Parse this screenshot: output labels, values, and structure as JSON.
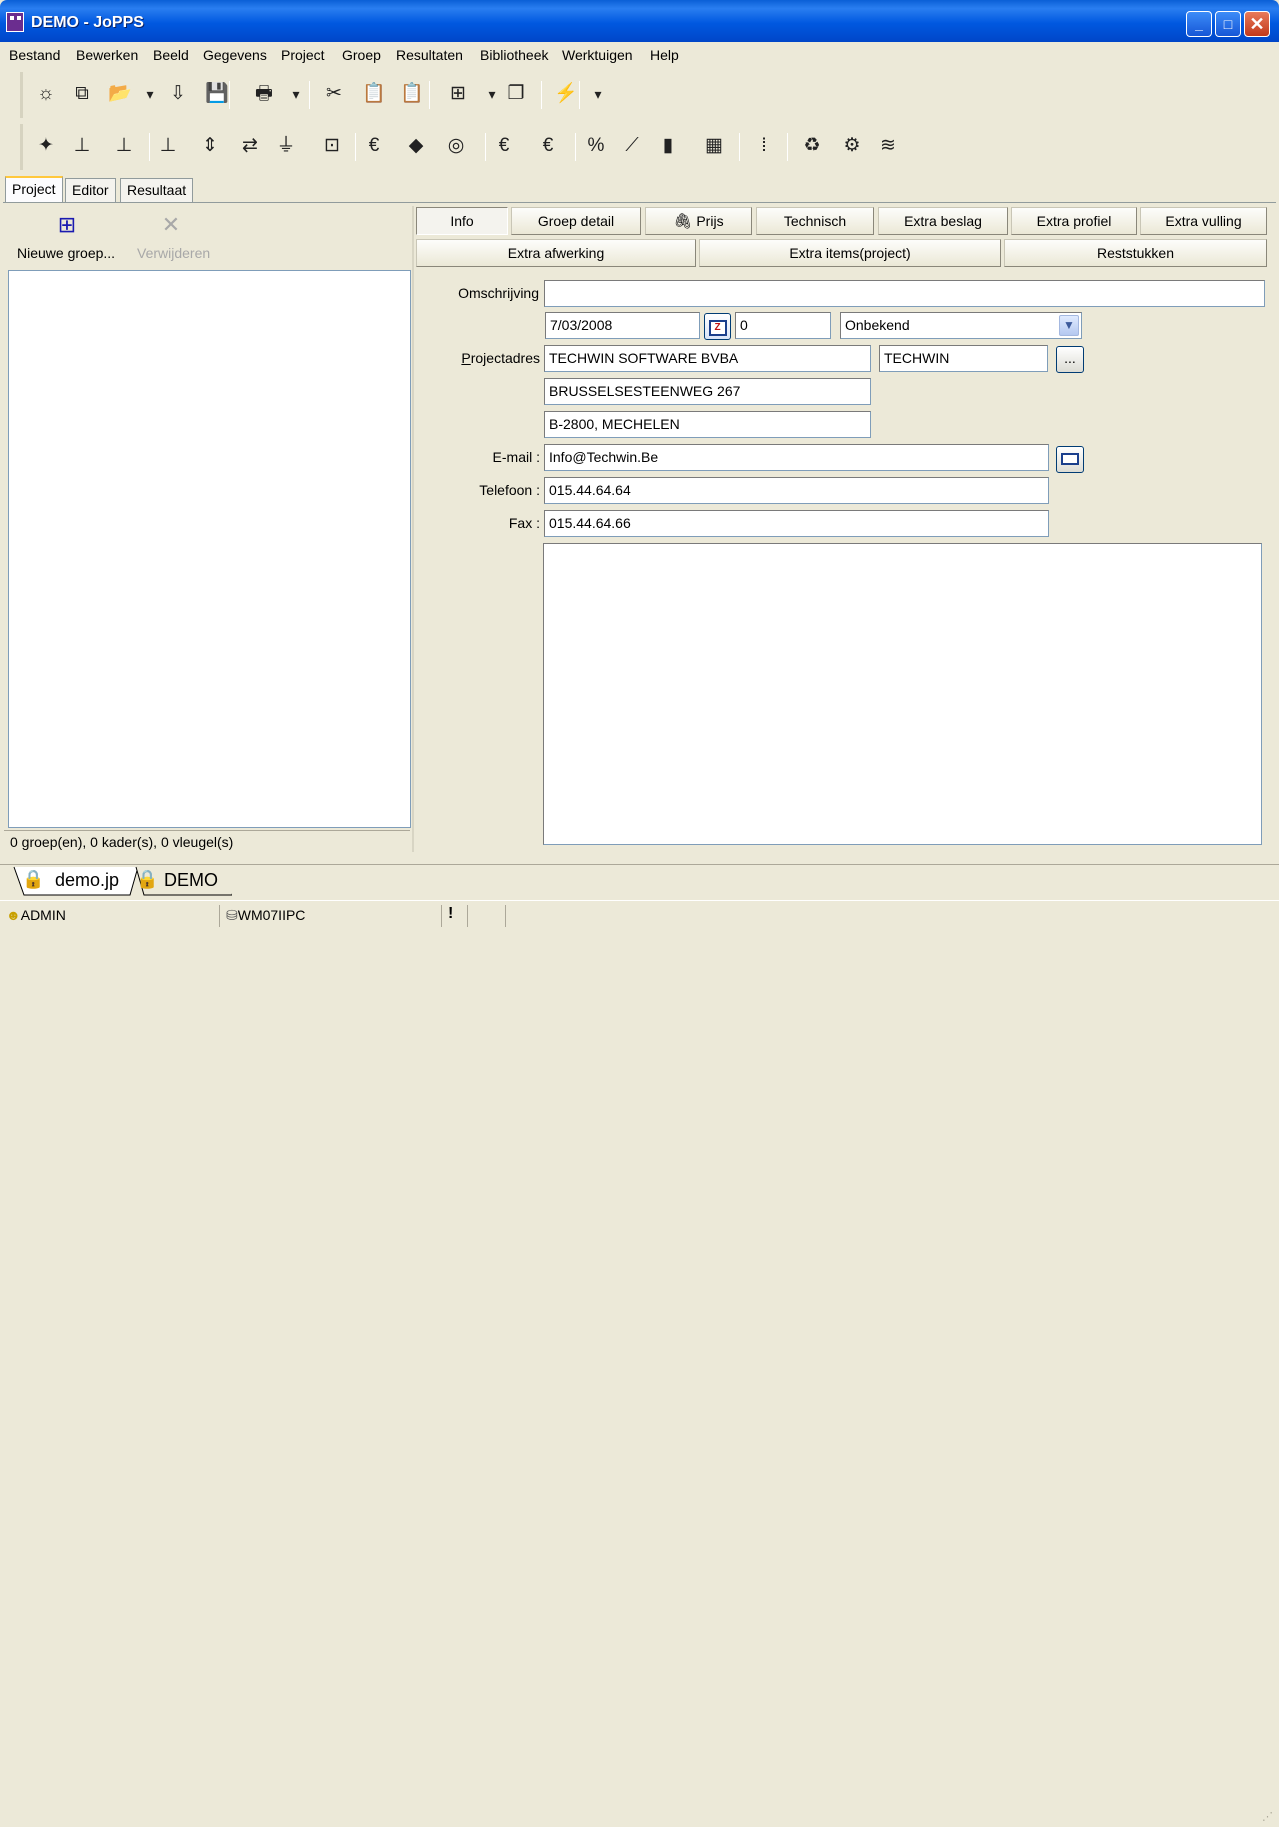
{
  "window": {
    "title": "DEMO - JoPPS",
    "minimize_glyph": "_",
    "maximize_glyph": "□",
    "close_glyph": "✕"
  },
  "menu": [
    "Bestand",
    "Bewerken",
    "Beeld",
    "Gegevens",
    "Project",
    "Groep",
    "Resultaten",
    "Bibliotheek",
    "Werktuigen",
    "Help"
  ],
  "toolbar1_icons": [
    {
      "name": "new-icon",
      "glyph": "☼"
    },
    {
      "name": "copy-icon",
      "glyph": "⧉"
    },
    {
      "name": "open-folder-icon",
      "glyph": "📂"
    },
    {
      "name": "dropdown-arrow-icon",
      "glyph": "▾"
    },
    {
      "name": "import-icon",
      "glyph": "⇩"
    },
    {
      "name": "save-icon",
      "glyph": "💾"
    },
    {
      "name": "print-icon",
      "glyph": "🖶"
    },
    {
      "name": "dropdown-arrow-icon",
      "glyph": "▾"
    },
    {
      "name": "cut-icon",
      "glyph": "✂"
    },
    {
      "name": "paste-icon",
      "glyph": "📋"
    },
    {
      "name": "paste-special-icon",
      "glyph": "📋"
    },
    {
      "name": "group-icon",
      "glyph": "⊞"
    },
    {
      "name": "dropdown-arrow-icon",
      "glyph": "▾"
    },
    {
      "name": "windows-icon",
      "glyph": "❐"
    },
    {
      "name": "lightning-icon",
      "glyph": "⚡"
    },
    {
      "name": "dropdown-arrow-icon",
      "glyph": "▾"
    }
  ],
  "toolbar2_icons": [
    {
      "name": "profile-wizard-icon",
      "glyph": "✦"
    },
    {
      "name": "profile-stack-icon",
      "glyph": "⊥"
    },
    {
      "name": "profile-icon",
      "glyph": "⊥"
    },
    {
      "name": "profile-price-icon",
      "glyph": "⊥"
    },
    {
      "name": "profile-dimension-icon",
      "glyph": "⇕"
    },
    {
      "name": "profile-connect-icon",
      "glyph": "⇄"
    },
    {
      "name": "weld-icon",
      "glyph": "⏚"
    },
    {
      "name": "frame-icon",
      "glyph": "⊡"
    },
    {
      "name": "glass-price-icon",
      "glyph": "€"
    },
    {
      "name": "cube-icon",
      "glyph": "◆"
    },
    {
      "name": "hardware-icon",
      "glyph": "◎"
    },
    {
      "name": "panel-price-icon",
      "glyph": "€"
    },
    {
      "name": "accessory-price-icon",
      "glyph": "€"
    },
    {
      "name": "discount-icon",
      "glyph": "%"
    },
    {
      "name": "price-graph-icon",
      "glyph": "⟋"
    },
    {
      "name": "price-chart-icon",
      "glyph": "▮"
    },
    {
      "name": "price-table-icon",
      "glyph": "▦"
    },
    {
      "name": "traffic-light-icon",
      "glyph": "⦙"
    },
    {
      "name": "recycle-icon",
      "glyph": "♻"
    },
    {
      "name": "gear-icon",
      "glyph": "⚙"
    },
    {
      "name": "coins-icon",
      "glyph": "≋"
    }
  ],
  "tabs": {
    "project": "Project",
    "editor": "Editor",
    "resultaat": "Resultaat"
  },
  "left": {
    "new_group_label": "Nieuwe groep...",
    "delete_label": "Verwijderen",
    "status": "0 groep(en), 0 kader(s), 0 vleugel(s)"
  },
  "detail_tabs_row1": [
    "Info",
    "Groep detail",
    "Prijs",
    "Technisch",
    "Extra beslag",
    "Extra profiel",
    "Extra vulling"
  ],
  "detail_tabs_row2": [
    "Extra afwerking",
    "Extra items(project)",
    "Reststukken"
  ],
  "form": {
    "omschrijving_label": "Omschrijving",
    "omschrijving_value": "",
    "date_value": "7/03/2008",
    "number_value": "0",
    "status_value": "Onbekend",
    "projectadres_label": "Projectadres",
    "address_line1": "TECHWIN SOFTWARE BVBA",
    "address_short": "TECHWIN",
    "address_line2": "BRUSSELSESTEENWEG 267",
    "address_line3": "B-2800, MECHELEN",
    "browse_label": "...",
    "email_label": "E-mail :",
    "email_value": "Info@Techwin.Be",
    "telefoon_label": "Telefoon :",
    "telefoon_value": "015.44.64.64",
    "fax_label": "Fax :",
    "fax_value": "015.44.64.66",
    "notes_value": ""
  },
  "doc_tabs": [
    "demo.jp",
    "DEMO"
  ],
  "statusbar": {
    "user": "ADMIN",
    "computer": "WM07IIPC",
    "alert": "!"
  },
  "colors": {
    "titlebar": "#0058e0",
    "window_bg": "#ece9d8",
    "field_border": "#7f9db9"
  }
}
